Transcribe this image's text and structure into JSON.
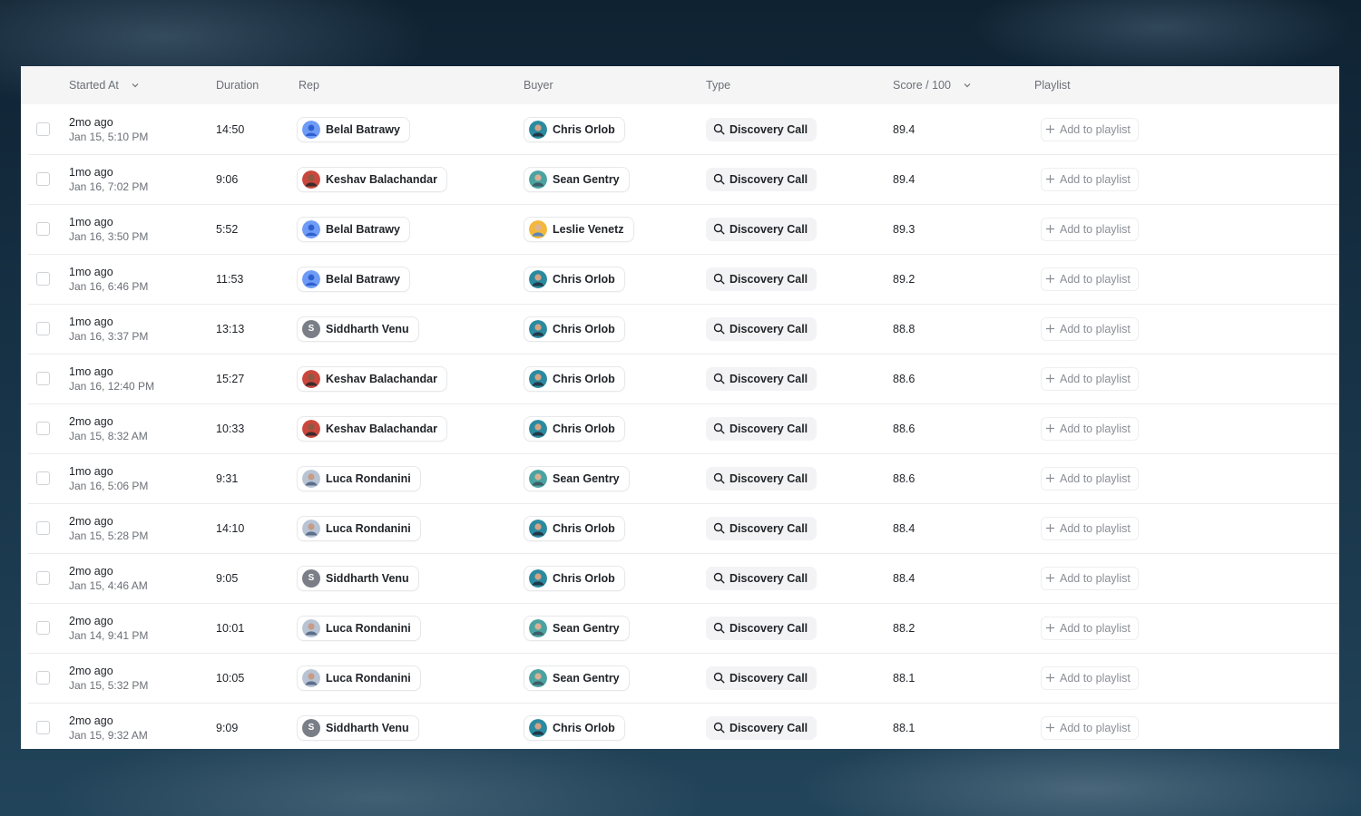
{
  "columns": {
    "started_at": "Started At",
    "duration": "Duration",
    "rep": "Rep",
    "buyer": "Buyer",
    "type": "Type",
    "score": "Score / 100",
    "playlist": "Playlist"
  },
  "playlist_action": "Add to playlist",
  "rows": [
    {
      "started_rel": "2mo ago",
      "started_abs": "Jan 15, 5:10 PM",
      "duration": "14:50",
      "rep": "Belal Batrawy",
      "rep_avatar": "person-icon",
      "buyer": "Chris Orlob",
      "buyer_avatar": "chris",
      "type": "Discovery Call",
      "score": "89.4"
    },
    {
      "started_rel": "1mo ago",
      "started_abs": "Jan 16, 7:02 PM",
      "duration": "9:06",
      "rep": "Keshav Balachandar",
      "rep_avatar": "keshav",
      "buyer": "Sean Gentry",
      "buyer_avatar": "sean",
      "type": "Discovery Call",
      "score": "89.4"
    },
    {
      "started_rel": "1mo ago",
      "started_abs": "Jan 16, 3:50 PM",
      "duration": "5:52",
      "rep": "Belal Batrawy",
      "rep_avatar": "person-icon",
      "buyer": "Leslie Venetz",
      "buyer_avatar": "leslie",
      "type": "Discovery Call",
      "score": "89.3"
    },
    {
      "started_rel": "1mo ago",
      "started_abs": "Jan 16, 6:46 PM",
      "duration": "11:53",
      "rep": "Belal Batrawy",
      "rep_avatar": "person-icon",
      "buyer": "Chris Orlob",
      "buyer_avatar": "chris",
      "type": "Discovery Call",
      "score": "89.2"
    },
    {
      "started_rel": "1mo ago",
      "started_abs": "Jan 16, 3:37 PM",
      "duration": "13:13",
      "rep": "Siddharth Venu",
      "rep_avatar": "S",
      "buyer": "Chris Orlob",
      "buyer_avatar": "chris",
      "type": "Discovery Call",
      "score": "88.8"
    },
    {
      "started_rel": "1mo ago",
      "started_abs": "Jan 16, 12:40 PM",
      "duration": "15:27",
      "rep": "Keshav Balachandar",
      "rep_avatar": "keshav",
      "buyer": "Chris Orlob",
      "buyer_avatar": "chris",
      "type": "Discovery Call",
      "score": "88.6"
    },
    {
      "started_rel": "2mo ago",
      "started_abs": "Jan 15, 8:32 AM",
      "duration": "10:33",
      "rep": "Keshav Balachandar",
      "rep_avatar": "keshav",
      "buyer": "Chris Orlob",
      "buyer_avatar": "chris",
      "type": "Discovery Call",
      "score": "88.6"
    },
    {
      "started_rel": "1mo ago",
      "started_abs": "Jan 16, 5:06 PM",
      "duration": "9:31",
      "rep": "Luca Rondanini",
      "rep_avatar": "luca",
      "buyer": "Sean Gentry",
      "buyer_avatar": "sean",
      "type": "Discovery Call",
      "score": "88.6"
    },
    {
      "started_rel": "2mo ago",
      "started_abs": "Jan 15, 5:28 PM",
      "duration": "14:10",
      "rep": "Luca Rondanini",
      "rep_avatar": "luca",
      "buyer": "Chris Orlob",
      "buyer_avatar": "chris",
      "type": "Discovery Call",
      "score": "88.4"
    },
    {
      "started_rel": "2mo ago",
      "started_abs": "Jan 15, 4:46 AM",
      "duration": "9:05",
      "rep": "Siddharth Venu",
      "rep_avatar": "S",
      "buyer": "Chris Orlob",
      "buyer_avatar": "chris",
      "type": "Discovery Call",
      "score": "88.4"
    },
    {
      "started_rel": "2mo ago",
      "started_abs": "Jan 14, 9:41 PM",
      "duration": "10:01",
      "rep": "Luca Rondanini",
      "rep_avatar": "luca",
      "buyer": "Sean Gentry",
      "buyer_avatar": "sean",
      "type": "Discovery Call",
      "score": "88.2"
    },
    {
      "started_rel": "2mo ago",
      "started_abs": "Jan 15, 5:32 PM",
      "duration": "10:05",
      "rep": "Luca Rondanini",
      "rep_avatar": "luca",
      "buyer": "Sean Gentry",
      "buyer_avatar": "sean",
      "type": "Discovery Call",
      "score": "88.1"
    },
    {
      "started_rel": "2mo ago",
      "started_abs": "Jan 15, 9:32 AM",
      "duration": "9:09",
      "rep": "Siddharth Venu",
      "rep_avatar": "S",
      "buyer": "Chris Orlob",
      "buyer_avatar": "chris",
      "type": "Discovery Call",
      "score": "88.1"
    }
  ]
}
